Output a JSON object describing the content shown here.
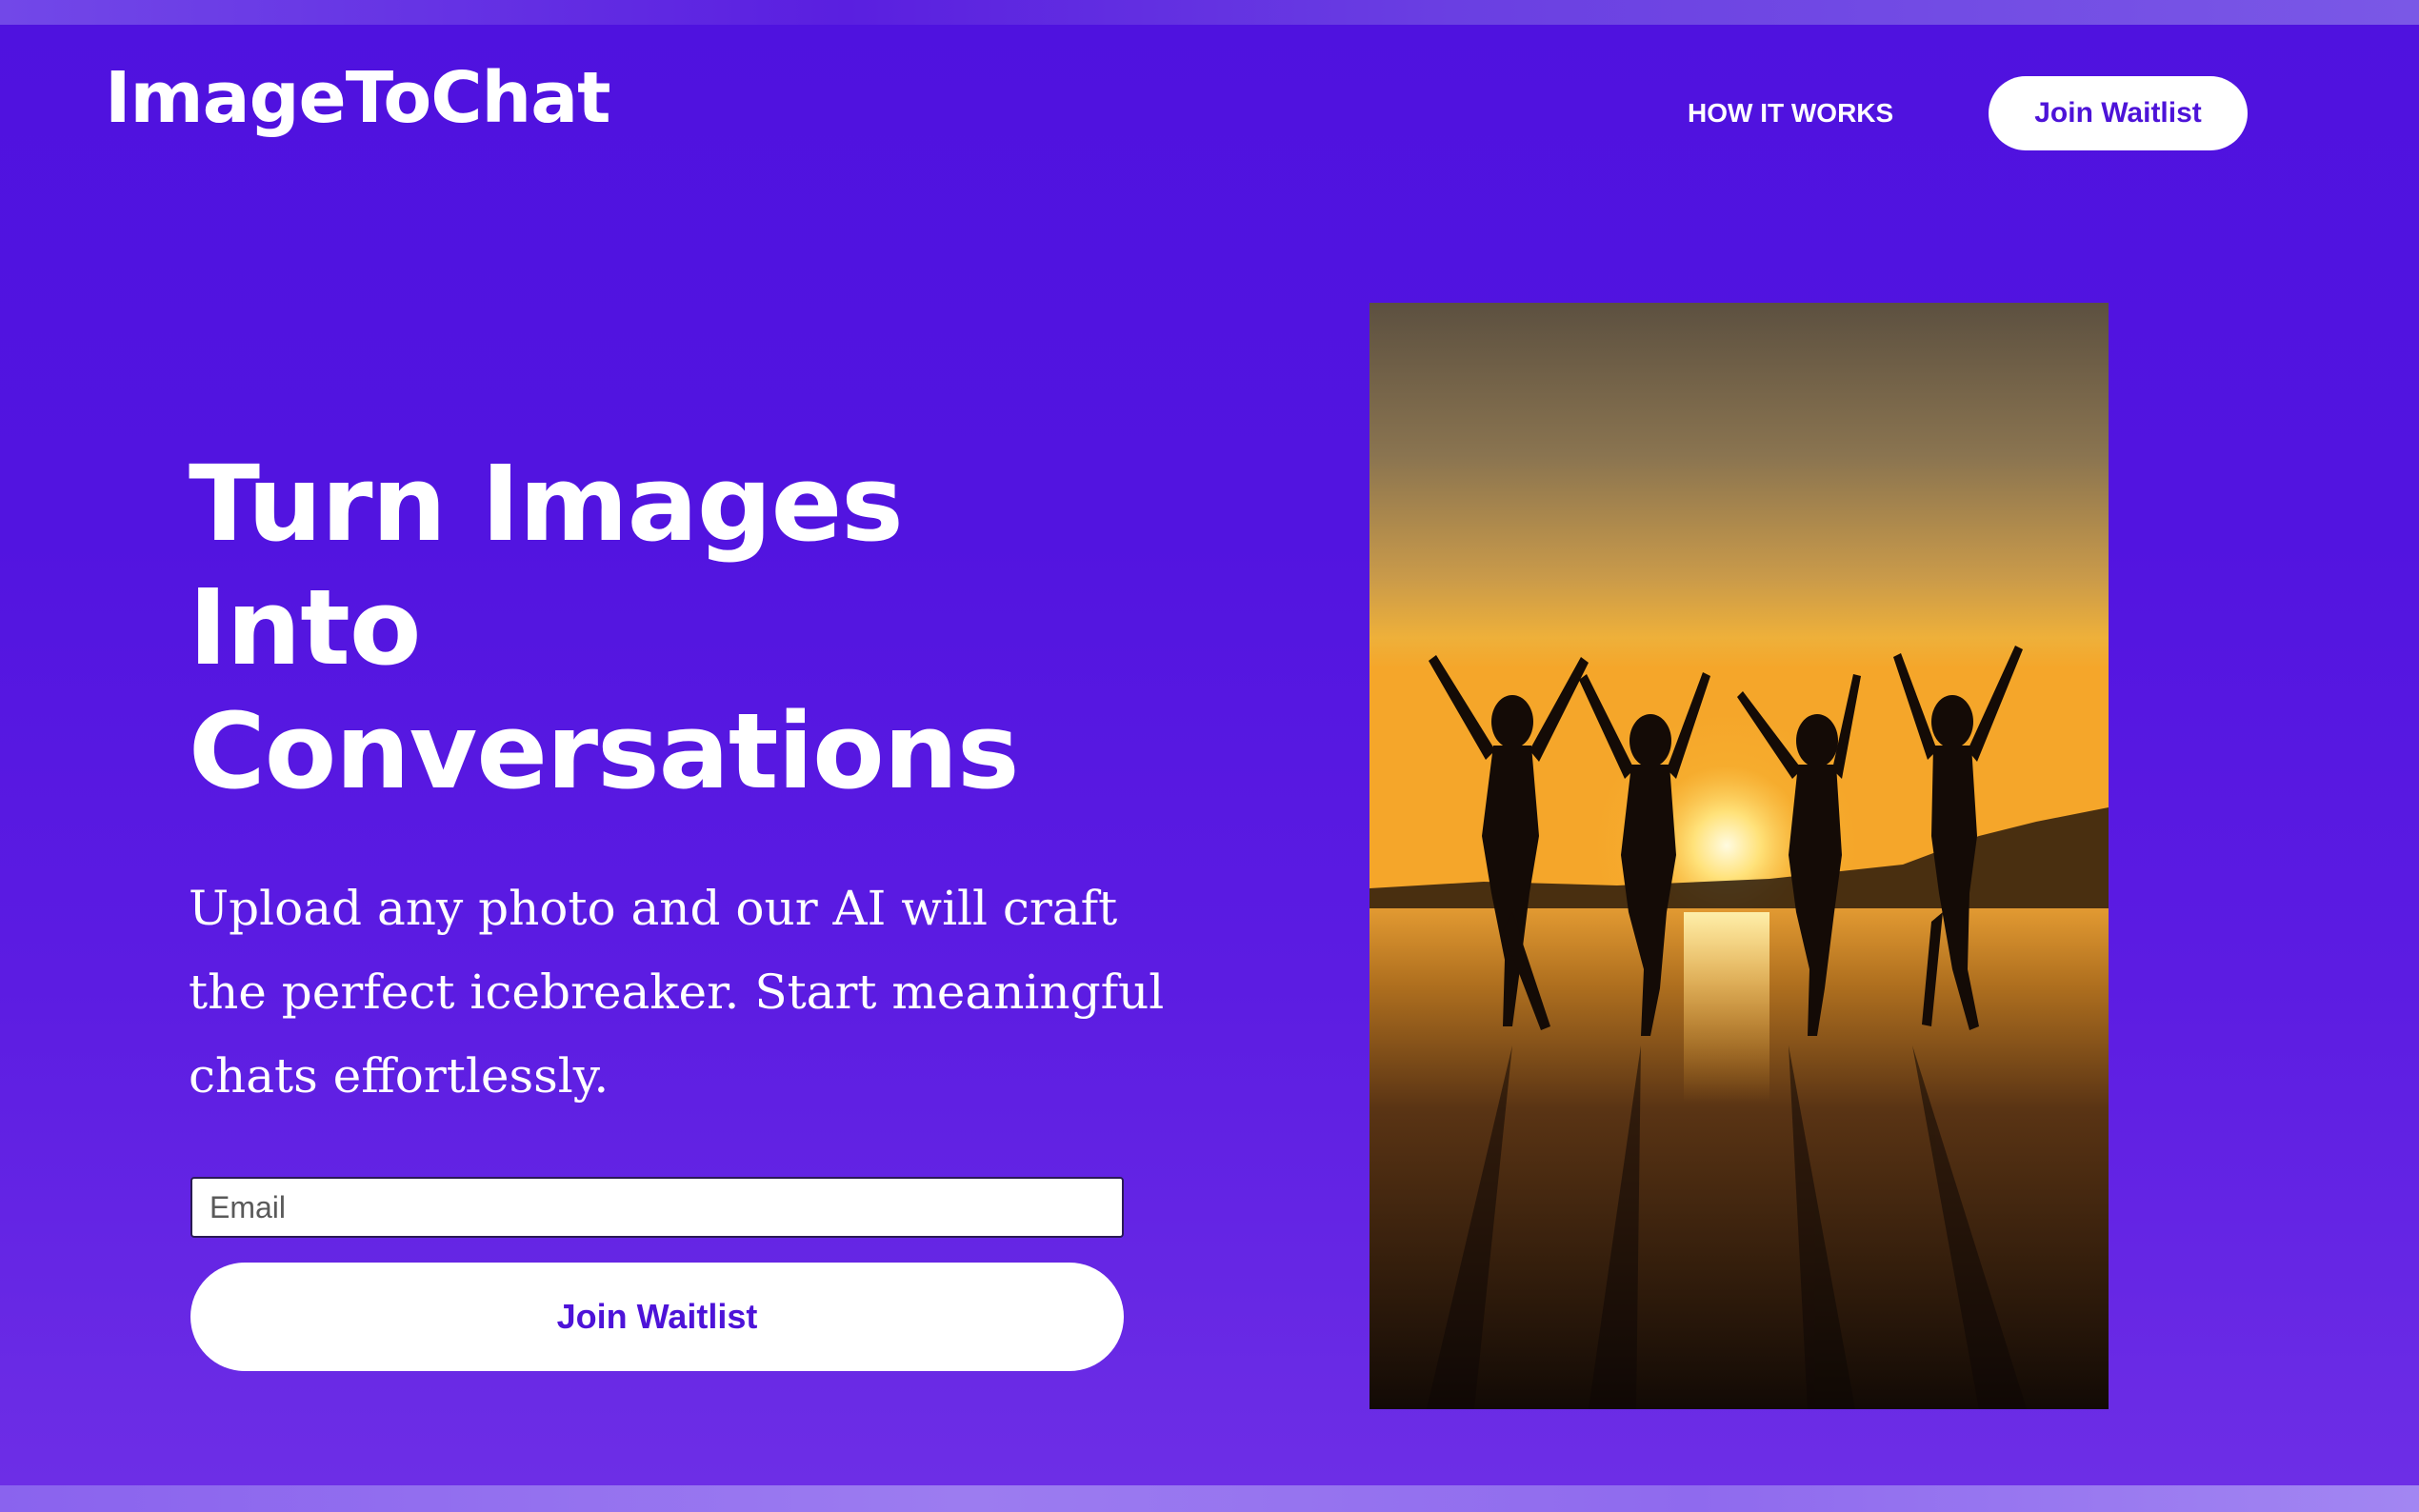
{
  "app": {
    "logo": "ImageToChat"
  },
  "nav": {
    "how_it_works": "HOW IT WORKS",
    "join_waitlist": "Join Waitlist"
  },
  "hero": {
    "headline_lines": [
      "Turn Images",
      "Into",
      "Conversations"
    ],
    "subtext_lines": [
      "Upload any photo and our AI will craft",
      "the perfect icebreaker. Start meaningful",
      "chats effortlessly."
    ],
    "email_placeholder": "Email",
    "email_value": "",
    "cta_label": "Join Waitlist"
  },
  "image": {
    "alt": "Four silhouetted women jumping on a beach at sunset",
    "alt_text_shown": false
  },
  "colors": {
    "brand_purple": "#5214e0",
    "button_text": "#4d13d8",
    "white": "#ffffff"
  }
}
